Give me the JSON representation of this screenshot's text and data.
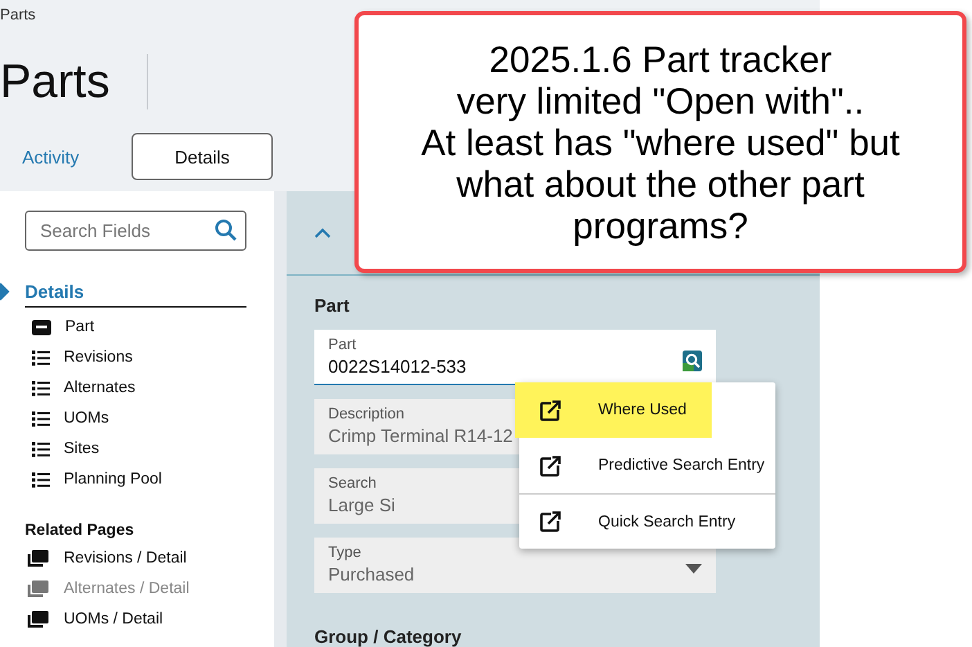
{
  "breadcrumb": "Parts",
  "page_title": "Parts",
  "tabs": [
    {
      "label": "Activity",
      "selected": false
    },
    {
      "label": "Details",
      "selected": true
    }
  ],
  "sidebar": {
    "search": {
      "placeholder": "Search Fields"
    },
    "section": {
      "title": "Details",
      "selected": true
    },
    "items": [
      {
        "label": "Part",
        "kind": "form"
      },
      {
        "label": "Revisions",
        "kind": "list"
      },
      {
        "label": "Alternates",
        "kind": "list"
      },
      {
        "label": "UOMs",
        "kind": "list"
      },
      {
        "label": "Sites",
        "kind": "list"
      },
      {
        "label": "Planning Pool",
        "kind": "list"
      }
    ],
    "related_title": "Related Pages",
    "related": [
      {
        "label": "Revisions / Detail",
        "disabled": false
      },
      {
        "label": "Alternates / Detail",
        "disabled": true
      },
      {
        "label": "UOMs / Detail",
        "disabled": false
      }
    ]
  },
  "panel": {
    "expanded": true,
    "section_title": "Part",
    "fields": [
      {
        "kind": "lookup",
        "label": "Part",
        "value": "0022S14012-533",
        "focused": true,
        "disabled": false
      },
      {
        "kind": "text",
        "label": "Description",
        "value": "Crimp Terminal R14-12",
        "focused": false,
        "disabled": true
      },
      {
        "kind": "text",
        "label": "Search",
        "value": "Large Si",
        "focused": false,
        "disabled": true
      },
      {
        "kind": "dropdown",
        "label": "Type",
        "value": "Purchased",
        "focused": false,
        "disabled": true
      }
    ],
    "next_section_title": "Group / Category"
  },
  "menu": {
    "items": [
      {
        "label": "Where Used",
        "highlighted": true,
        "divider_before": false
      },
      {
        "label": "Predictive Search Entry",
        "highlighted": false,
        "divider_before": false
      },
      {
        "label": "Quick Search Entry",
        "highlighted": false,
        "divider_before": true
      }
    ]
  },
  "callout": {
    "lines": [
      "2025.1.6 Part tracker",
      "very limited \"Open with\"..",
      "At least has \"where used\" but",
      "what about the other part",
      "programs?"
    ]
  }
}
